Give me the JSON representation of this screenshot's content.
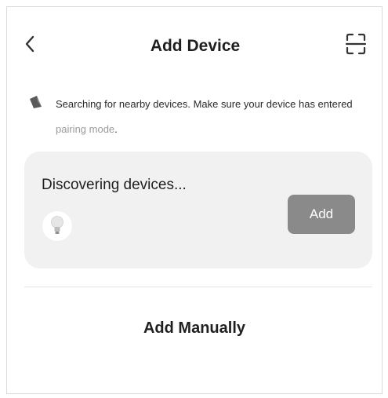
{
  "header": {
    "back_icon": "chevron-left-icon",
    "title": "Add Device",
    "scan_icon": "scan-icon"
  },
  "notice": {
    "icon": "radar-icon",
    "text": "Searching for nearby devices. Make sure your device has entered ",
    "link_text": "pairing mode",
    "suffix": "."
  },
  "discovery_card": {
    "status": "Discovering devices...",
    "device_icon": "light-bulb-icon",
    "add_label": "Add"
  },
  "footer": {
    "manual_label": "Add Manually"
  },
  "colors": {
    "card_background": "#f1f1f1",
    "button_background": "#8a8a8a",
    "link_gray": "#9a9a9a"
  }
}
